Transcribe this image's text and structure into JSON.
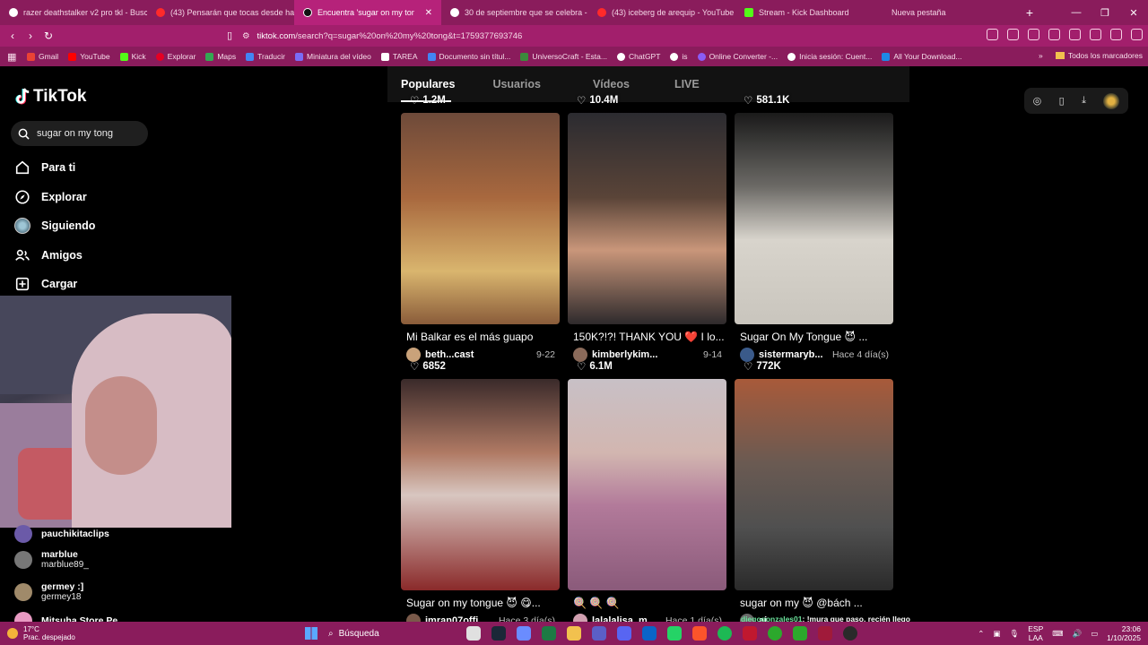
{
  "browser": {
    "tabs": [
      {
        "label": "razer deathstalker v2 pro tkl - Busca",
        "color": "#ffffff"
      },
      {
        "label": "(43) Pensarán que tocas desde hace",
        "color": "#ff2a2a"
      },
      {
        "label": "Encuentra 'sugar on my tong' en",
        "color": "#111111",
        "active": true
      },
      {
        "label": "30 de septiembre que se celebra - B",
        "color": "#ffffff"
      },
      {
        "label": "(43) iceberg de arequip - YouTube",
        "color": "#ff2a2a"
      },
      {
        "label": "Stream - Kick Dashboard",
        "color": "#53fc18"
      },
      {
        "label": "Nueva pestaña",
        "color": ""
      }
    ],
    "url_domain": "tiktok.com",
    "url_path": "/search?q=sugar%20on%20my%20tong&t=1759377693746",
    "bookmarks": [
      {
        "label": "Gmail",
        "color": "#ea4335"
      },
      {
        "label": "YouTube",
        "color": "#ff0000"
      },
      {
        "label": "Kick",
        "color": "#53fc18"
      },
      {
        "label": "Explorar",
        "color": "#e60023"
      },
      {
        "label": "Maps",
        "color": "#34a853"
      },
      {
        "label": "Traducir",
        "color": "#4285f4"
      },
      {
        "label": "Miniatura del vídeo",
        "color": "#ffd94a"
      },
      {
        "label": "TAREA",
        "color": "#ffffff"
      },
      {
        "label": "Documento sin títul...",
        "color": "#4285f4"
      },
      {
        "label": "UniversoCraft - Esta...",
        "color": "#3c8a3c"
      },
      {
        "label": "ChatGPT",
        "color": "#ffffff"
      },
      {
        "label": "is",
        "color": "#ffffff"
      },
      {
        "label": "Online Converter -...",
        "color": "#8a5cf5"
      },
      {
        "label": "Inicia sesión: Cuent...",
        "color": "#ffffff"
      },
      {
        "label": "All Your Download...",
        "color": "#1e88e5"
      }
    ],
    "bookmarks_folder": "Todos los marcadores"
  },
  "sidebar": {
    "brand": "TikTok",
    "search_value": "sugar on my tong",
    "nav": [
      {
        "label": "Para ti",
        "icon": "home-icon"
      },
      {
        "label": "Explorar",
        "icon": "compass-icon"
      },
      {
        "label": "Siguiendo",
        "icon": "following-avatar"
      },
      {
        "label": "Amigos",
        "icon": "friends-icon"
      },
      {
        "label": "Cargar",
        "icon": "upload-icon"
      }
    ],
    "following": [
      {
        "name": "pauchikitaclips",
        "handle": "",
        "color": "#6b5aa8"
      },
      {
        "name": "marblue",
        "handle": "marblue89_",
        "color": "#777777"
      },
      {
        "name": "germey :]",
        "handle": "germey18",
        "color": "#a08a6a"
      },
      {
        "name": "Mitsuha Store Pe...",
        "handle": "",
        "color": "#e89ac2"
      }
    ]
  },
  "main": {
    "tabs": [
      "Populares",
      "Usuarios",
      "Vídeos",
      "LIVE"
    ],
    "active_tab": "Populares",
    "videos": [
      {
        "likes": "1.2M",
        "caption": "Mi Balkar es el más guapo",
        "user": "beth...cast",
        "date": "9-22",
        "bg": "linear-gradient(180deg,#6e4a3a 0%,#a8683e 40%,#d9b56e 75%,#8a5c3a 100%)",
        "avatar": "#c9a27a"
      },
      {
        "likes": "10.4M",
        "caption": "150K?!?! THANK YOU ❤️ I lo...",
        "user": "kimberlykim...",
        "date": "9-14",
        "bg": "linear-gradient(180deg,#2b2b30 0%,#5a4438 40%,#c9967a 65%,#2e2a2c 100%)",
        "avatar": "#8a6a5a"
      },
      {
        "likes": "581.1K",
        "caption": "Sugar On My Tongue 😈 ...",
        "user": "sistermaryb...",
        "date": "Hace 4 día(s)",
        "bg": "linear-gradient(180deg,#1a1a1a 0%,#6c6a66 35%,#d8d4cc 60%,#c9c5bd 100%)",
        "avatar": "#3a5a8a"
      },
      {
        "likes": "6852",
        "caption": "Sugar on my tongue 😈 😋...",
        "user": "imran07offi...",
        "date": "Hace 3 día(s)",
        "bg": "linear-gradient(180deg,#3a2a2a 0%,#b07a64 35%,#d8c6c0 55%,#8a2a2a 100%)",
        "avatar": "#7a5a4a"
      },
      {
        "likes": "6.1M",
        "caption": "🍭 🍭 🍭",
        "user": "lalalalisa_m",
        "date": "Hace 1 día(s)",
        "bg": "linear-gradient(180deg,#c8c0c6 0%,#d2b6b0 35%,#b27a9a 60%,#8a5a7a 100%)",
        "avatar": "#d0a0b0"
      },
      {
        "likes": "772K",
        "caption": "sugar on my 😈 @bách ...",
        "user": "ai...",
        "date": "",
        "bg": "linear-gradient(180deg,#a85a3a 0%,#6a5a52 40%,#505050 70%,#2a2a2a 100%)",
        "avatar": "#6a6a6a"
      }
    ]
  },
  "taskbar": {
    "temperature": "17°C",
    "weather": "Prac. despejado",
    "search_label": "Búsqueda",
    "lang_line1": "ESP",
    "lang_line2": "LAA",
    "time": "23:06",
    "date": "1/10/2025"
  },
  "chat_overlay": {
    "user": "diegogonzales01",
    "message": ": !mura que paso, recién llego"
  }
}
